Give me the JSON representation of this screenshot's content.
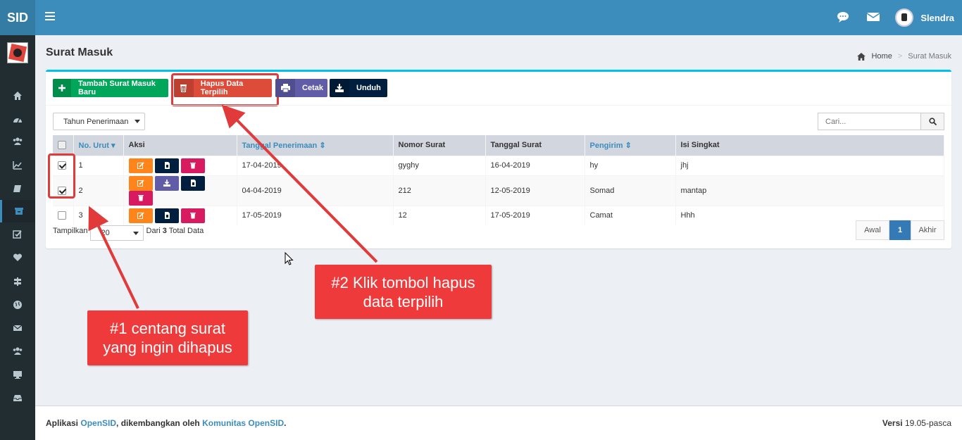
{
  "app": {
    "logo": "SID",
    "user_name": "Slendra"
  },
  "page": {
    "title": "Surat Masuk",
    "breadcrumb_home": "Home",
    "breadcrumb_current": "Surat Masuk"
  },
  "toolbar": {
    "add_label": "Tambah Surat Masuk Baru",
    "delete_label": "Hapus Data Terpilih",
    "print_label": "Cetak",
    "download_label": "Unduh"
  },
  "filter": {
    "year_select": "Tahun Penerimaan",
    "search_placeholder": "Cari..."
  },
  "table": {
    "headers": [
      "No. Urut",
      "Aksi",
      "Tanggal Penerimaan",
      "Nomor Surat",
      "Tanggal Surat",
      "Pengirim",
      "Isi Singkat"
    ],
    "rows": [
      {
        "no": "1",
        "tgl_terima": "17-04-2019",
        "nomor": "gyghy",
        "tgl_surat": "16-04-2019",
        "pengirim": "hy",
        "isi": "jhj",
        "checked": true
      },
      {
        "no": "2",
        "tgl_terima": "04-04-2019",
        "nomor": "212",
        "tgl_surat": "12-05-2019",
        "pengirim": "Somad",
        "isi": "mantap",
        "checked": true
      },
      {
        "no": "3",
        "tgl_terima": "17-05-2019",
        "nomor": "12",
        "tgl_surat": "17-05-2019",
        "pengirim": "Camat",
        "isi": "Hhh",
        "checked": false
      }
    ]
  },
  "paging": {
    "show_label": "Tampilkan",
    "per_page": "20",
    "from_label": "Dari",
    "total": "3",
    "total_label": "Total Data",
    "first": "Awal",
    "current": "1",
    "last": "Akhir"
  },
  "annotations": {
    "step1": "#1 centang surat yang ingin dihapus",
    "step2": "#2 Klik tombol hapus data terpilih"
  },
  "footer": {
    "app_label": "Aplikasi",
    "app_link": "OpenSID",
    "dev_label": ", dikembangkan oleh",
    "dev_link": "Komunitas OpenSID",
    "end": ".",
    "version_label": "Versi",
    "version": "19.05-pasca"
  },
  "colors": {
    "header": "#3c8dbc",
    "sidebar": "#222d32",
    "accent": "#00c0ef",
    "annotation": "#ee3a3a"
  }
}
